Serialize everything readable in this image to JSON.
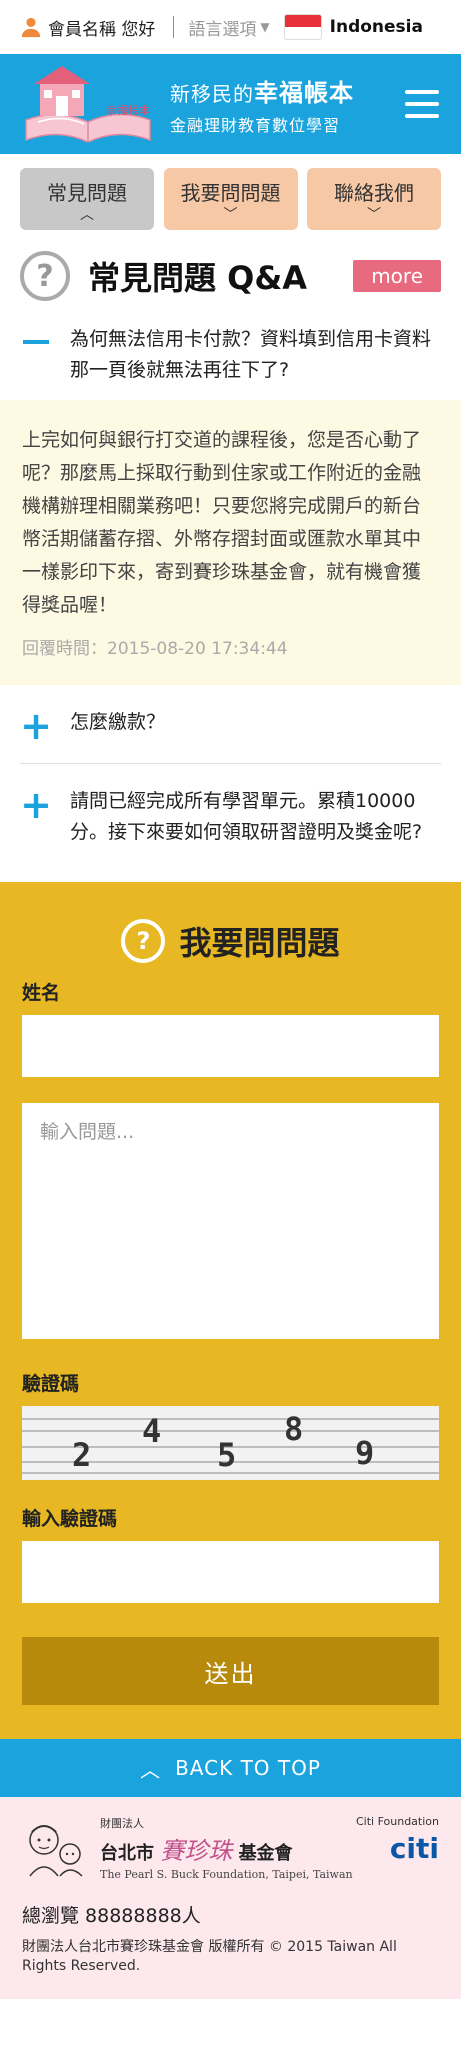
{
  "topbar": {
    "user_label": "會員名稱 您好",
    "language_label": "語言選項",
    "language_name": "Indonesia"
  },
  "header": {
    "logo_title_small": "新移民的",
    "logo_title_big": "幸福帳本",
    "logo_subtitle": "金融理財教育數位學習",
    "logo_book_text": "幸福帳本",
    "brand_color": "#1aa3dd"
  },
  "tabs": [
    {
      "label": "常見問題",
      "active": true
    },
    {
      "label": "我要問問題",
      "active": false
    },
    {
      "label": "聯絡我們",
      "active": false
    }
  ],
  "faq": {
    "heading": "常見問題 Q&A",
    "more_label": "more",
    "open_question": "為何無法信用卡付款？資料填到信用卡資料那一頁後就無法再往下了?",
    "open_answer": "上完如何與銀行打交道的課程後，您是否心動了呢？那麼馬上採取行動到住家或工作附近的金融機構辦理相關業務吧！只要您將完成開戶的新台幣活期儲蓄存摺、外幣存摺封面或匯款水單其中一樣影印下來，寄到賽珍珠基金會，就有機會獲得獎品喔！",
    "answer_time": "回覆時間：2015-08-20 17:34:44",
    "collapsed_questions": [
      "怎麼繳款？",
      "請問已經完成所有學習單元。累積10000分。接下來要如何領取研習證明及獎金呢?"
    ]
  },
  "ask_form": {
    "heading": "我要問問題",
    "name_label": "姓名",
    "name_value": "",
    "question_placeholder": "輸入問題...",
    "captcha_label": "驗證碼",
    "captcha_digits": [
      "2",
      "4",
      "5",
      "8",
      "9"
    ],
    "captcha_input_label": "輸入驗證碼",
    "captcha_input_value": "",
    "submit_label": "送出"
  },
  "back_to_top": "BACK TO TOP",
  "footer": {
    "foundation_small": "財團法人",
    "foundation_city": "台北市",
    "foundation_cursive": "賽珍珠",
    "foundation_suffix": "基金會",
    "foundation_en": "The Pearl S. Buck Foundation, Taipei, Taiwan",
    "citi_foundation": "Citi Foundation",
    "citi_logo": "citi",
    "visits": "總瀏覽 88888888人",
    "copyright": "財團法人台北市賽珍珠基金會 版權所有 © 2015 Taiwan All Rights Reserved."
  }
}
